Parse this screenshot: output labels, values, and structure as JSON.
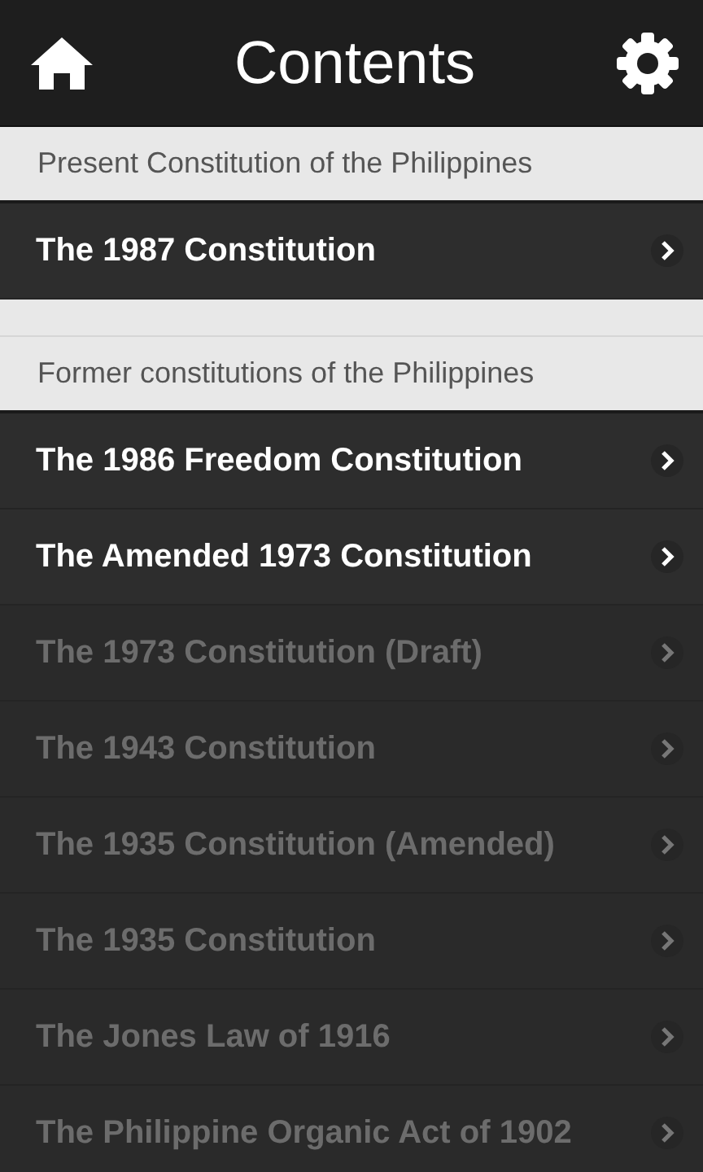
{
  "header": {
    "title": "Contents"
  },
  "sections": [
    {
      "heading": "Present Constitution of the Philippines",
      "items": [
        {
          "label": "The 1987 Constitution",
          "disabled": false
        }
      ]
    },
    {
      "heading": "Former constitutions of the Philippines",
      "items": [
        {
          "label": "The 1986 Freedom Constitution",
          "disabled": false
        },
        {
          "label": "The Amended 1973 Constitution",
          "disabled": false
        },
        {
          "label": "The 1973 Constitution (Draft)",
          "disabled": true
        },
        {
          "label": "The 1943 Constitution",
          "disabled": true
        },
        {
          "label": "The 1935 Constitution (Amended)",
          "disabled": true
        },
        {
          "label": "The 1935 Constitution",
          "disabled": true
        },
        {
          "label": "The Jones Law of 1916",
          "disabled": true
        },
        {
          "label": "The Philippine Organic Act of 1902",
          "disabled": true
        }
      ]
    }
  ]
}
